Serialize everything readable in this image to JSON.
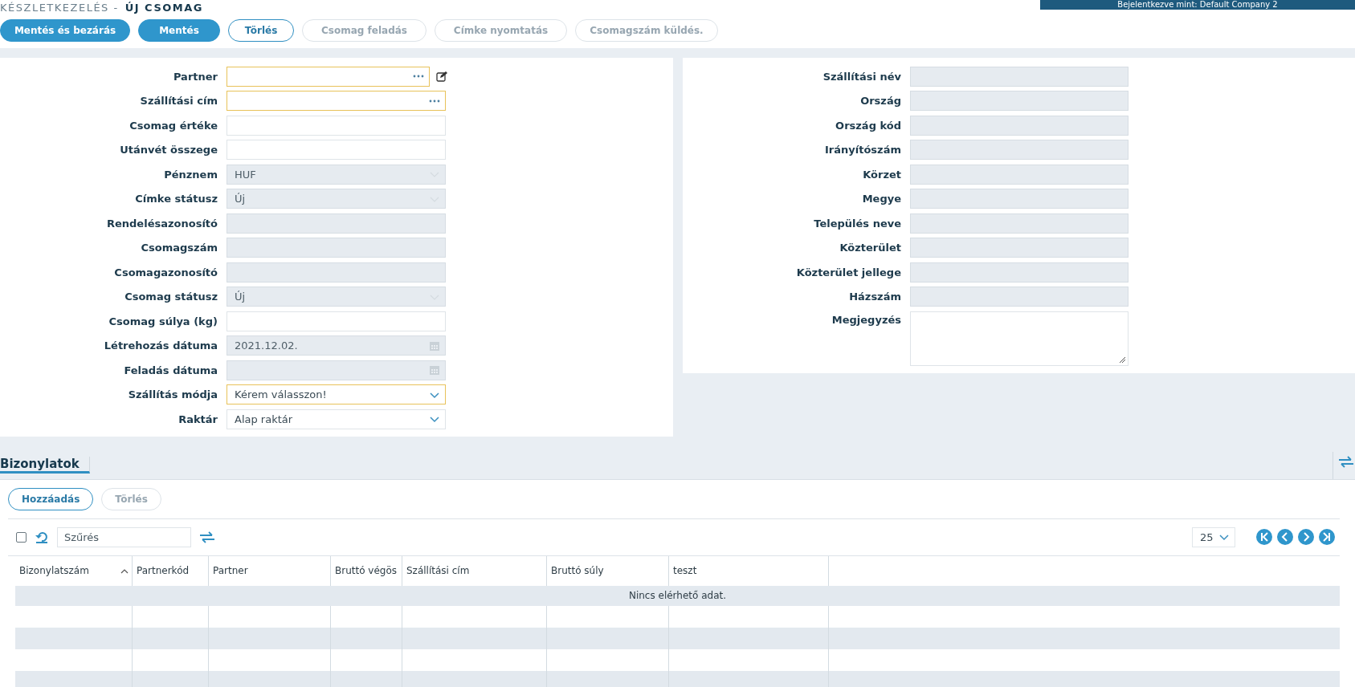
{
  "header": {
    "breadcrumb": "KÉSZLETKEZELÉS -",
    "title": "ÚJ CSOMAG",
    "user_banner": "Bejelentkezve mint: Default Company 2"
  },
  "toolbar": [
    {
      "label": "Mentés és bezárás",
      "kind": "primary",
      "disabled": false
    },
    {
      "label": "Mentés",
      "kind": "primary",
      "disabled": false
    },
    {
      "label": "Törlés",
      "kind": "outline",
      "disabled": false
    },
    {
      "label": "Csomag feladás",
      "kind": "outline",
      "disabled": true
    },
    {
      "label": "Címke nyomtatás",
      "kind": "outline",
      "disabled": true
    },
    {
      "label": "Csomagszám küldés.",
      "kind": "outline",
      "disabled": true
    }
  ],
  "left_form": [
    {
      "label": "Partner",
      "kind": "lookup",
      "disabled": false,
      "required": true,
      "edit_button": true
    },
    {
      "label": "Szállítási cím",
      "kind": "lookup",
      "disabled": false,
      "required": true,
      "edit_button": false
    },
    {
      "label": "Csomag értéke",
      "kind": "text",
      "disabled": false,
      "required": false,
      "edit_button": false
    },
    {
      "label": "Utánvét összege",
      "kind": "text",
      "disabled": false,
      "required": false,
      "edit_button": false
    },
    {
      "label": "Pénznem",
      "kind": "select",
      "value": "HUF",
      "disabled": true,
      "required": false,
      "edit_button": false
    },
    {
      "label": "Címke státusz",
      "kind": "select",
      "value": "Új",
      "disabled": true,
      "required": false,
      "edit_button": false
    },
    {
      "label": "Rendelésazonosító",
      "kind": "text",
      "disabled": true,
      "required": false,
      "edit_button": false
    },
    {
      "label": "Csomagszám",
      "kind": "text",
      "disabled": true,
      "required": false,
      "edit_button": false
    },
    {
      "label": "Csomagazonosító",
      "kind": "text",
      "disabled": true,
      "required": false,
      "edit_button": false
    },
    {
      "label": "Csomag státusz",
      "kind": "select",
      "value": "Új",
      "disabled": true,
      "required": false,
      "edit_button": false
    },
    {
      "label": "Csomag súlya (kg)",
      "kind": "text",
      "disabled": false,
      "required": false,
      "edit_button": false
    },
    {
      "label": "Létrehozás dátuma",
      "kind": "date",
      "value": "2021.12.02.",
      "disabled": true,
      "required": false,
      "edit_button": false
    },
    {
      "label": "Feladás dátuma",
      "kind": "date",
      "disabled": true,
      "required": false,
      "edit_button": false
    },
    {
      "label": "Szállítás módja",
      "kind": "select",
      "value": "Kérem válasszon!",
      "disabled": false,
      "required": true,
      "edit_button": false
    },
    {
      "label": "Raktár",
      "kind": "select",
      "value": "Alap raktár",
      "disabled": false,
      "required": false,
      "edit_button": false
    }
  ],
  "right_form": [
    {
      "label": "Szállítási név",
      "kind": "text",
      "disabled": true
    },
    {
      "label": "Ország",
      "kind": "text",
      "disabled": true
    },
    {
      "label": "Ország kód",
      "kind": "text",
      "disabled": true
    },
    {
      "label": "Irányítószám",
      "kind": "text",
      "disabled": true
    },
    {
      "label": "Körzet",
      "kind": "text",
      "disabled": true
    },
    {
      "label": "Megye",
      "kind": "text",
      "disabled": true
    },
    {
      "label": "Település neve",
      "kind": "text",
      "disabled": true
    },
    {
      "label": "Közterület",
      "kind": "text",
      "disabled": true
    },
    {
      "label": "Közterület jellege",
      "kind": "text",
      "disabled": true
    },
    {
      "label": "Házszám",
      "kind": "text",
      "disabled": true
    },
    {
      "label": "Megjegyzés",
      "kind": "textarea",
      "disabled": false
    }
  ],
  "tabs": [
    {
      "label": "Bizonylatok",
      "selected": true
    }
  ],
  "grid_buttons": [
    {
      "label": "Hozzáadás",
      "disabled": false
    },
    {
      "label": "Törlés",
      "disabled": true
    }
  ],
  "grid_toolbar": {
    "select_all_checked": false,
    "filter_placeholder": "Szűrés",
    "page_size": "25"
  },
  "table": {
    "columns": [
      {
        "label": "Bizonylatszám",
        "sorted": true
      },
      {
        "label": "Partnerkód",
        "sorted": false
      },
      {
        "label": "Partner",
        "sorted": false
      },
      {
        "label": "Bruttó végös",
        "sorted": false
      },
      {
        "label": "Szállítási cím",
        "sorted": false
      },
      {
        "label": "Bruttó súly",
        "sorted": false
      },
      {
        "label": "teszt",
        "sorted": false
      }
    ],
    "empty_message": "Nincs elérhető adat."
  }
}
